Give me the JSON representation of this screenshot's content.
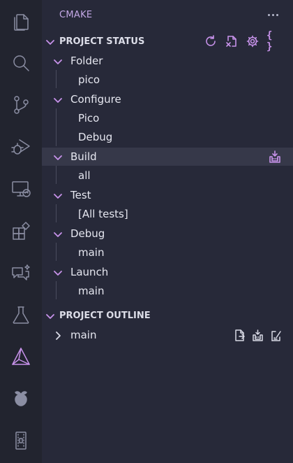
{
  "activity_bar": {
    "items": [
      {
        "icon": "files-icon"
      },
      {
        "icon": "search-icon"
      },
      {
        "icon": "source-control-icon"
      },
      {
        "icon": "run-debug-icon"
      },
      {
        "icon": "remote-explorer-icon"
      },
      {
        "icon": "extensions-icon"
      },
      {
        "icon": "chat-icon"
      },
      {
        "icon": "testing-icon"
      },
      {
        "icon": "cmake-icon",
        "active": true
      },
      {
        "icon": "raspberry-pi-icon"
      },
      {
        "icon": "board-icon"
      }
    ]
  },
  "panel": {
    "title": "CMAKE",
    "more_label": "..."
  },
  "project_status": {
    "header": "PROJECT STATUS",
    "actions": [
      "refresh-icon",
      "delete-cache-icon",
      "settings-icon",
      "json-braces-icon"
    ],
    "brace_label": "{ }",
    "groups": [
      {
        "label": "Folder",
        "children": [
          "pico"
        ]
      },
      {
        "label": "Configure",
        "children": [
          "Pico",
          "Debug"
        ]
      },
      {
        "label": "Build",
        "children": [
          "all"
        ],
        "selected": true
      },
      {
        "label": "Test",
        "children": [
          "[All tests]"
        ]
      },
      {
        "label": "Debug",
        "children": [
          "main"
        ]
      },
      {
        "label": "Launch",
        "children": [
          "main"
        ]
      }
    ]
  },
  "project_outline": {
    "header": "PROJECT OUTLINE",
    "items": [
      {
        "label": "main",
        "expanded": false
      }
    ]
  },
  "colors": {
    "accent": "#c792ea",
    "background": "#272939",
    "activity_bar": "#22242f",
    "selection": "#363849"
  }
}
